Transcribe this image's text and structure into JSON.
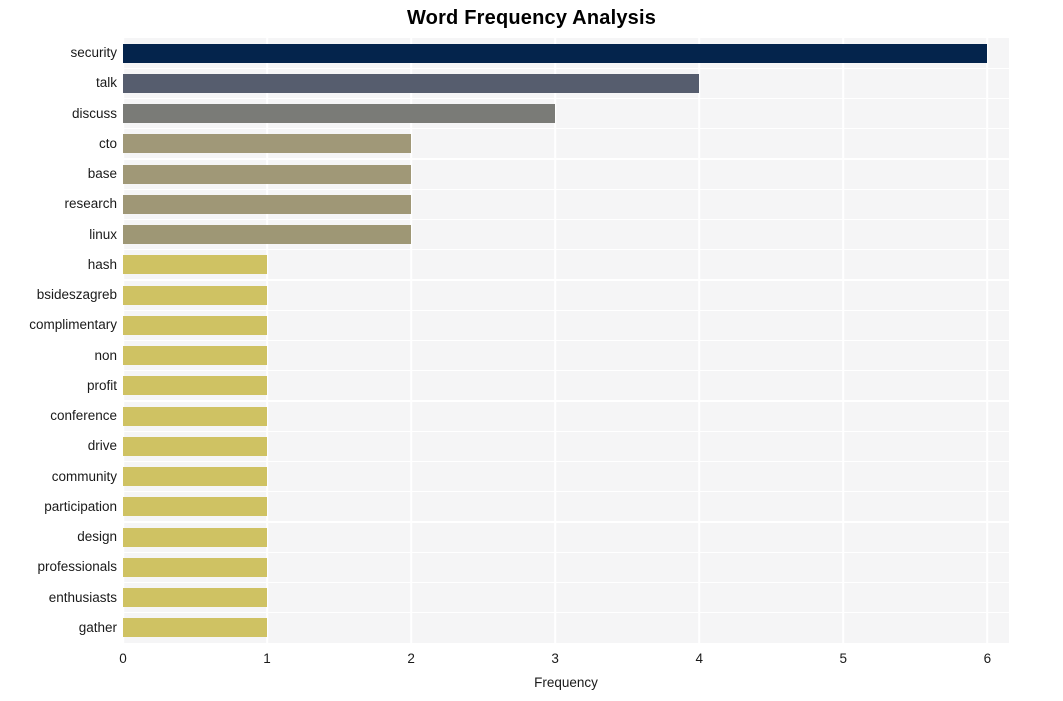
{
  "chart_data": {
    "type": "bar",
    "orientation": "horizontal",
    "title": "Word Frequency Analysis",
    "xlabel": "Frequency",
    "ylabel": "",
    "xlim": [
      0,
      6.15
    ],
    "xticks": [
      0,
      1,
      2,
      3,
      4,
      5,
      6
    ],
    "xtick_labels": [
      "0",
      "1",
      "2",
      "3",
      "4",
      "5",
      "6"
    ],
    "grid": true,
    "grid_axis": "x",
    "legend": null,
    "plot_background": "#f5f5f6",
    "grid_color": "#ffffff",
    "categories": [
      "security",
      "talk",
      "discuss",
      "cto",
      "base",
      "research",
      "linux",
      "hash",
      "bsideszagreb",
      "complimentary",
      "non",
      "profit",
      "conference",
      "drive",
      "community",
      "participation",
      "design",
      "professionals",
      "enthusiasts",
      "gather"
    ],
    "values": [
      6,
      4,
      3,
      2,
      2,
      2,
      2,
      1,
      1,
      1,
      1,
      1,
      1,
      1,
      1,
      1,
      1,
      1,
      1,
      1
    ],
    "bar_colors": [
      "#04244c",
      "#565d6e",
      "#7a7b77",
      "#a09878",
      "#a09877",
      "#9f9776",
      "#9e9775",
      "#cfc263",
      "#cfc263",
      "#cfc263",
      "#cfc263",
      "#cfc263",
      "#cfc263",
      "#cfc263",
      "#cfc263",
      "#cfc263",
      "#cfc263",
      "#cfc263",
      "#cfc263",
      "#cfc263"
    ]
  }
}
